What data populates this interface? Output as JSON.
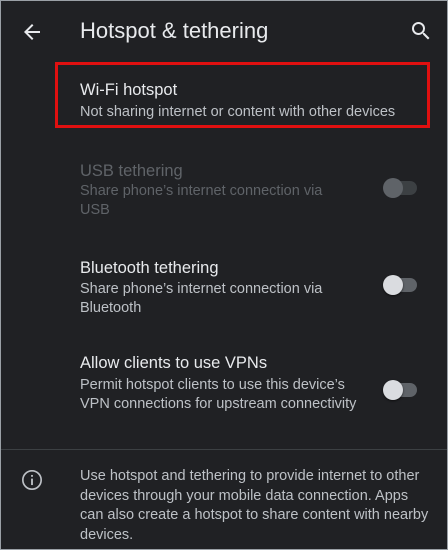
{
  "toolbar": {
    "title": "Hotspot & tethering",
    "back_icon": "arrow-back-icon",
    "search_icon": "search-icon"
  },
  "preferences": [
    {
      "title": "Wi-Fi hotspot",
      "summary": "Not sharing internet or content with other devices",
      "enabled": true,
      "highlighted": true
    },
    {
      "title": "USB tethering",
      "summary": "Share phone’s internet connection via USB",
      "enabled": false,
      "switch_on": false
    },
    {
      "title": "Bluetooth tethering",
      "summary": "Share phone’s internet connection via Bluetooth",
      "enabled": true,
      "switch_on": false
    },
    {
      "title": "Allow clients to use VPNs",
      "summary": "Permit hotspot clients to use this device’s VPN connections for upstream connectivity",
      "enabled": true,
      "switch_on": false
    }
  ],
  "footer": {
    "icon": "info-icon",
    "text": "Use hotspot and tethering to provide internet to other devices through your mobile data connection. Apps can also create a hotspot to share content with nearby devices."
  },
  "colors": {
    "background": "#202124",
    "highlight_border": "#e01010",
    "primary_text": "#e8eaed",
    "secondary_text": "#bdc1c6",
    "disabled_text": "#5f6368"
  }
}
